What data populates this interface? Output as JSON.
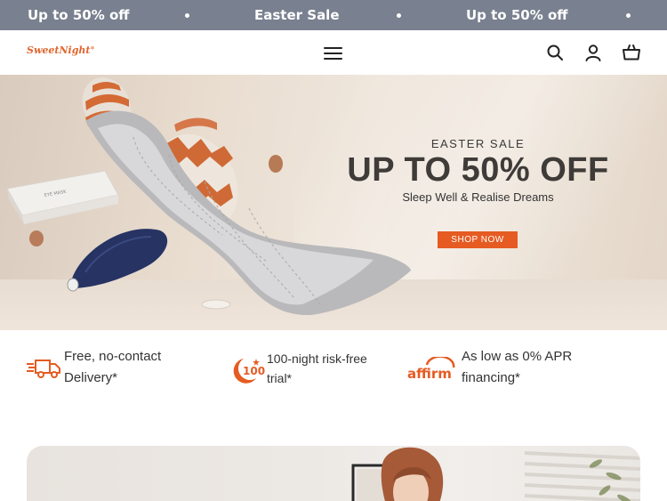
{
  "announcement": {
    "items": [
      "Up to 50% off",
      "Easter Sale",
      "Up to 50% off"
    ]
  },
  "header": {
    "logo": "SweetNight",
    "icons": [
      "menu-icon",
      "search-icon",
      "account-icon",
      "cart-icon"
    ]
  },
  "hero": {
    "kicker": "EASTER SALE",
    "title": "UP TO 50% OFF",
    "subtitle": "Sleep Well & Realise Dreams",
    "cta": "SHOP NOW"
  },
  "features": [
    {
      "icon": "delivery-truck-icon",
      "line1": "Free, no-contact",
      "line2": "Delivery*"
    },
    {
      "icon": "100-night-icon",
      "line1": "100-night risk-free",
      "line2": "trial*"
    },
    {
      "icon": "affirm-logo",
      "line1": "As low as 0% APR",
      "line2": "financing*"
    }
  ],
  "colors": {
    "announcement_bg": "#79808f",
    "brand_orange": "#e55b22",
    "text_dark": "#333333"
  }
}
